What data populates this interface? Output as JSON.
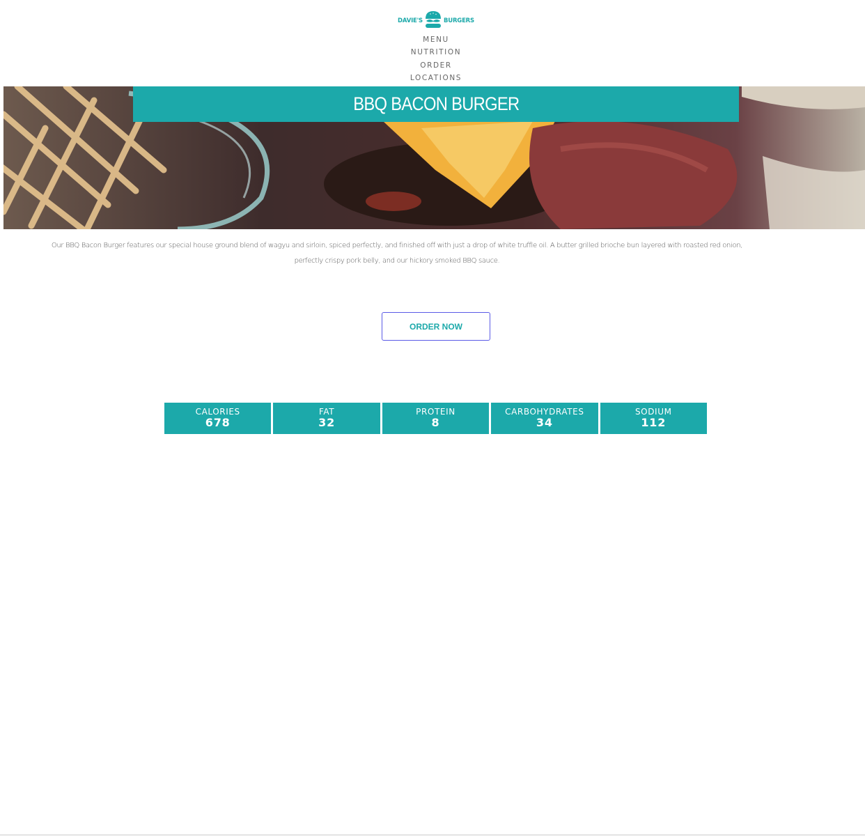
{
  "header": {
    "logo": {
      "left_word": "DAVIE'S",
      "right_word": "BURGERS",
      "icon": "burger-mustache-icon"
    }
  },
  "nav": {
    "items": [
      {
        "label": "MENU"
      },
      {
        "label": "NUTRITION"
      },
      {
        "label": "ORDER"
      },
      {
        "label": "LOCATIONS"
      }
    ]
  },
  "hero": {
    "title": "BBQ BACON BURGER",
    "image": "burger-and-fries-photo"
  },
  "description": "Our BBQ Bacon Burger features our special house ground blend of wagyu and sirloin, spiced perfectly, and finished off with just a drop of white truffle oil. A butter grilled brioche bun layered with roasted red onion, perfectly crispy pork belly, and our hickory smoked BBQ sauce.",
  "order_button": {
    "label": "ORDER NOW"
  },
  "nutrition": [
    {
      "label": "CALORIES",
      "value": "678"
    },
    {
      "label": "FAT",
      "value": "32"
    },
    {
      "label": "PROTEIN",
      "value": "8"
    },
    {
      "label": "CARBOHYDRATES",
      "value": "34"
    },
    {
      "label": "SODIUM",
      "value": "112"
    }
  ],
  "colors": {
    "accent": "#1ca9aa",
    "button_border": "#5a5ae6",
    "text": "#555555"
  }
}
